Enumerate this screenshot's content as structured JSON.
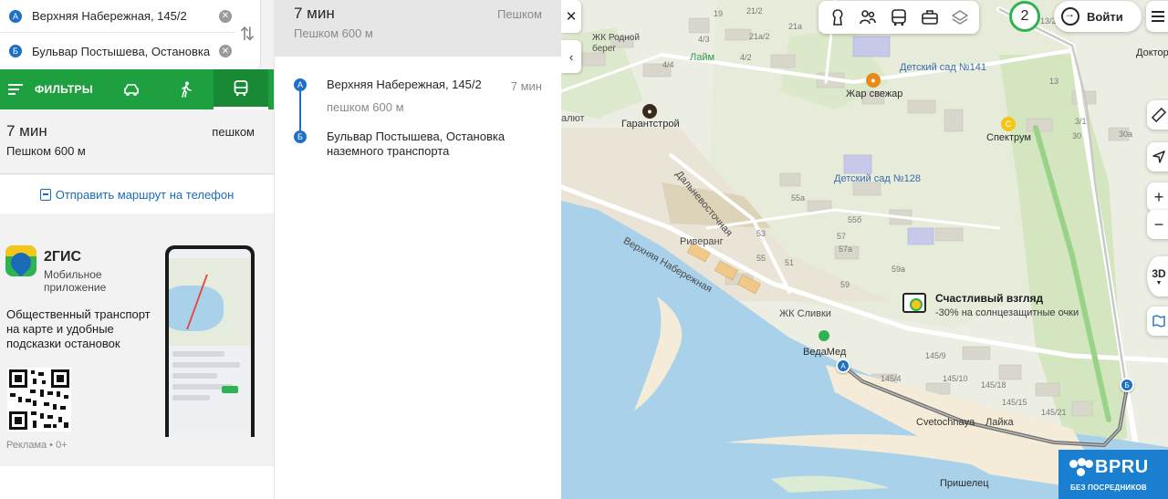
{
  "route": {
    "from": "Верхняя Набережная, 145/2",
    "to": "Бульвар Постышева, Остановка наземного транспорта",
    "from_marker": "А",
    "to_marker": "Б"
  },
  "modes": {
    "filters_label": "ФИЛЬТРЫ",
    "active": "bus",
    "items": [
      "car",
      "pedestrian",
      "bus"
    ]
  },
  "summary": {
    "time": "7 мин",
    "mode": "пешком",
    "detail": "Пешком 600 м"
  },
  "send_to_phone": "Отправить маршрут на телефон",
  "promo": {
    "brand": "2ГИС",
    "subtitle": "Мобильное приложение",
    "text": "Общественный транспорт на карте и удобные подсказки остановок",
    "ad_label": "Реклама • 0+"
  },
  "details": {
    "time": "7 мин",
    "mode": "Пешком",
    "distance": "Пешком 600 м",
    "segments": [
      {
        "marker": "А",
        "title": "Верхняя Набережная, 145/2",
        "duration": "7 мин",
        "note": "пешком 600 м"
      },
      {
        "marker": "Б",
        "title": "Бульвар Постышева, Остановка наземного транспорта"
      }
    ]
  },
  "map": {
    "zoom_level": "2",
    "login": "Войти",
    "labels": {
      "zhk_rodnoy": "ЖК Родной берег",
      "laim": "Лайм",
      "garantstroy": "Гарантстрой",
      "zhar": "Жар свежар",
      "ds141": "Детский сад №141",
      "spectrum": "Спектрум",
      "ds128": "Детский сад №128",
      "dalnevost": "Дальневосточная",
      "verkhnyaya": "Верхняя Набережная",
      "riverang": "Риверанг",
      "sliwki": "ЖК Сливки",
      "vedamed": "ВедаМед",
      "cvetochnaya": "Cvetochnaya",
      "layka": "Лайка",
      "prishelec": "Пришелец",
      "doktor": "Докторок",
      "alyut": "алют"
    },
    "ad": {
      "title": "Счастливый взгляд",
      "subtitle": "-30% на солнцезащитные очки"
    },
    "view_3d": "3D",
    "watermark": "BPRU",
    "watermark_sub": "БЕЗ ПОСРЕДНИКОВ",
    "building_numbers": [
      "21/2",
      "4/4",
      "4/3",
      "4/2",
      "19",
      "21а/2",
      "21а",
      "3/1",
      "13/2",
      "13",
      "55а",
      "55б",
      "57",
      "57а",
      "59а",
      "59",
      "53",
      "51",
      "55",
      "145/9",
      "145/4",
      "145/18",
      "145/21",
      "145/15",
      "145/10",
      "30а",
      "30"
    ]
  },
  "colors": {
    "brand_green": "#1fa040",
    "accent_blue": "#1f6fc5",
    "link_blue": "#1a6bb8",
    "water": "#a9d2ea"
  }
}
